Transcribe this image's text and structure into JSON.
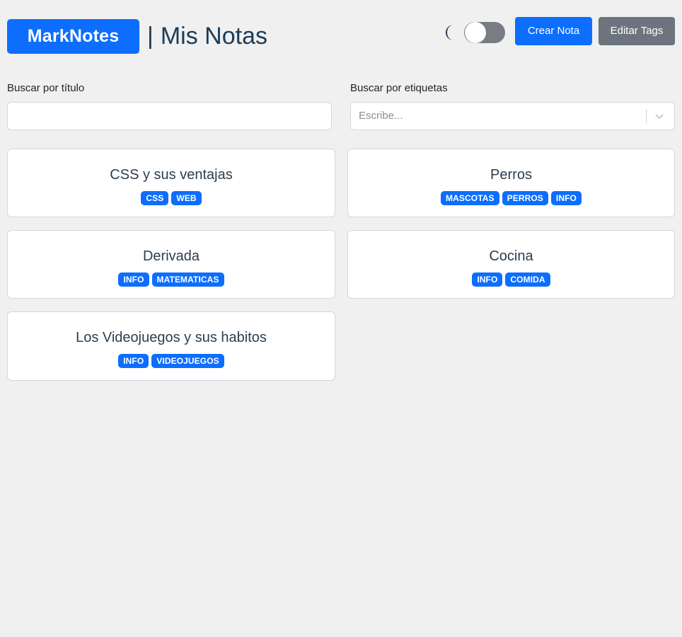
{
  "header": {
    "brand": "MarkNotes",
    "separator": "|",
    "title": "Mis Notas",
    "create_button": "Crear Nota",
    "edit_tags_button": "Editar Tags"
  },
  "search": {
    "title_label": "Buscar por título",
    "title_value": "",
    "tags_label": "Buscar por etiquetas",
    "tags_placeholder": "Escribe..."
  },
  "icons": {
    "theme": "moon-icon",
    "dropdown": "chevron-down-icon"
  },
  "theme_toggle": {
    "dark_mode": false
  },
  "colors": {
    "primary": "#0d6efd",
    "secondary": "#6c757d",
    "background": "#f0f0f0",
    "title": "#1c3c57"
  },
  "notes": [
    {
      "title": "CSS y sus ventajas",
      "tags": [
        "CSS",
        "WEB"
      ]
    },
    {
      "title": "Perros",
      "tags": [
        "MASCOTAS",
        "PERROS",
        "INFO"
      ]
    },
    {
      "title": "Derivada",
      "tags": [
        "INFO",
        "MATEMATICAS"
      ]
    },
    {
      "title": "Cocina",
      "tags": [
        "INFO",
        "COMIDA"
      ]
    },
    {
      "title": "Los Videojuegos y sus habitos",
      "tags": [
        "INFO",
        "VIDEOJUEGOS"
      ]
    }
  ]
}
